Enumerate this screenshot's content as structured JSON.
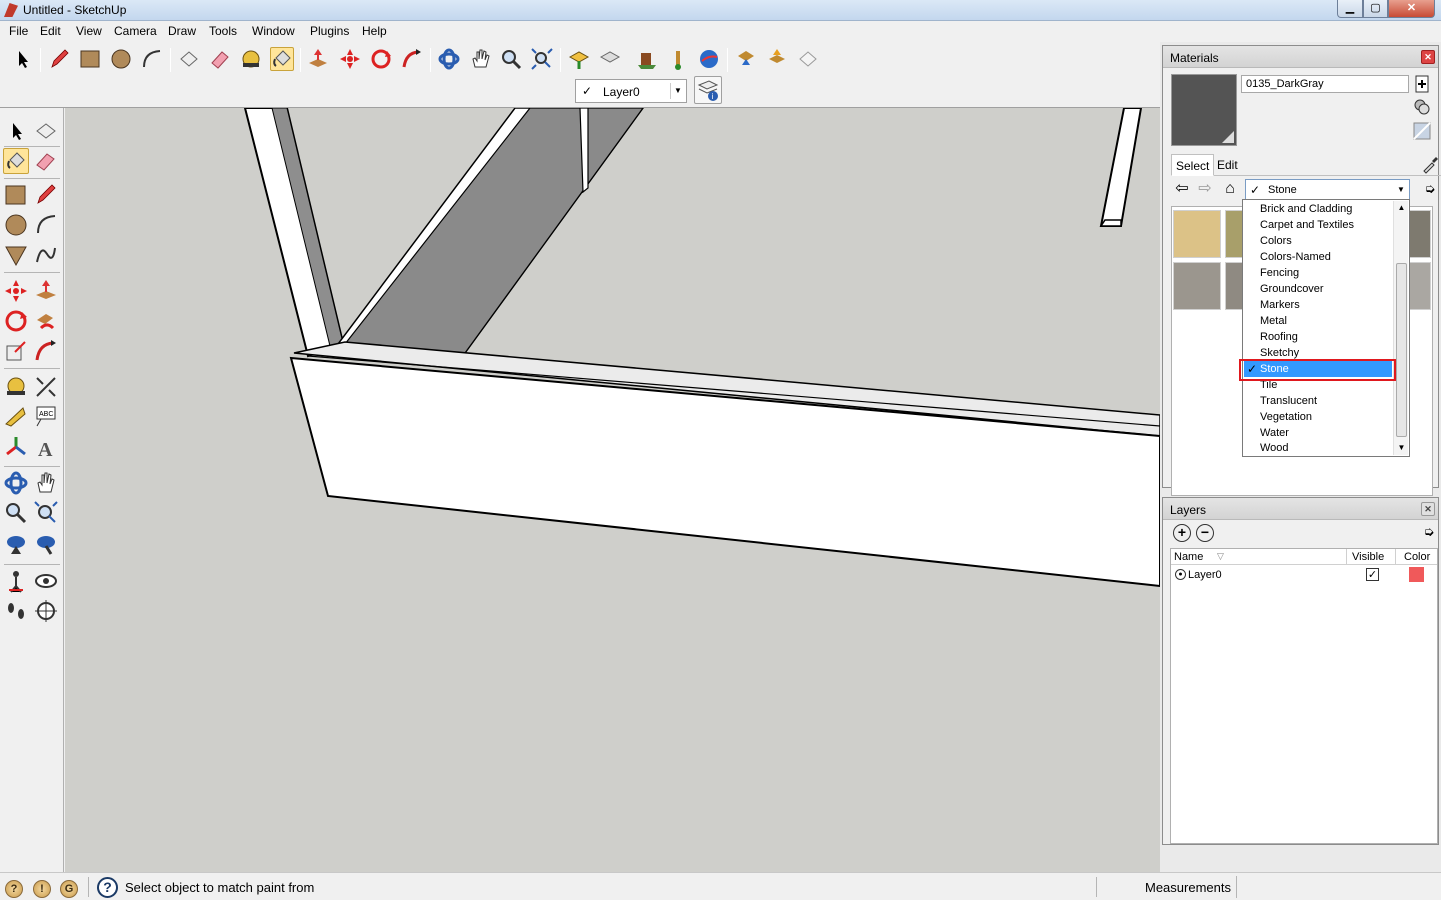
{
  "window": {
    "title": "Untitled - SketchUp",
    "controls": {
      "minimize": "▁",
      "maximize": "▢",
      "close": "✕"
    }
  },
  "menu": [
    "File",
    "Edit",
    "View",
    "Camera",
    "Draw",
    "Tools",
    "Window",
    "Plugins",
    "Help"
  ],
  "toolbar": {
    "layer_select": {
      "checked": "✓",
      "value": "Layer0"
    },
    "tools": [
      "select-icon",
      "pencil-icon",
      "rectangle-icon",
      "circle-icon",
      "arc-icon",
      "make-component-icon",
      "eraser-icon",
      "tape-measure-icon",
      "paint-bucket-icon",
      "push-pull-icon",
      "move-icon",
      "rotate-icon",
      "follow-me-icon",
      "orbit-icon",
      "pan-icon",
      "zoom-icon",
      "zoom-extents-icon",
      "get-models-icon",
      "share-model-icon",
      "share-component-icon",
      "get-photo-texture-icon",
      "preview-google-earth-icon",
      "get-models-warehouse-icon",
      "upload-models-icon",
      "extension-icon"
    ]
  },
  "materials": {
    "title": "Materials",
    "close": "✕",
    "current_name": "0135_DarkGray",
    "current_color": "#545454",
    "tabs": [
      "Select",
      "Edit"
    ],
    "collection": {
      "checked": "✓",
      "value": "Stone"
    },
    "collections": [
      "Brick and Cladding",
      "Carpet and Textiles",
      "Colors",
      "Colors-Named",
      "Fencing",
      "Groundcover",
      "Markers",
      "Metal",
      "Roofing",
      "Sketchy",
      "Stone",
      "Tile",
      "Translucent",
      "Vegetation",
      "Water",
      "Wood"
    ],
    "selected_index": 10,
    "selected_check": "✓",
    "thumbnails": [
      "#dcc287",
      "#a89f6a",
      "#7e7a6f",
      "#9b968e",
      "#8f8a82",
      "#aaa7a2",
      "#8a8680",
      "#9a9a95"
    ]
  },
  "layers": {
    "title": "Layers",
    "close": "✕",
    "add": "+",
    "remove": "−",
    "columns": [
      "Name",
      "Visible",
      "Color"
    ],
    "rows": [
      {
        "name": "Layer0",
        "visible": "✓",
        "color": "#f0595a"
      }
    ]
  },
  "status": {
    "hint": "Select object to match paint from",
    "measurements_label": "Measurements",
    "icons": [
      "geo-location-icon",
      "credits-icon",
      "google-sign-in-icon"
    ],
    "help": "?"
  }
}
